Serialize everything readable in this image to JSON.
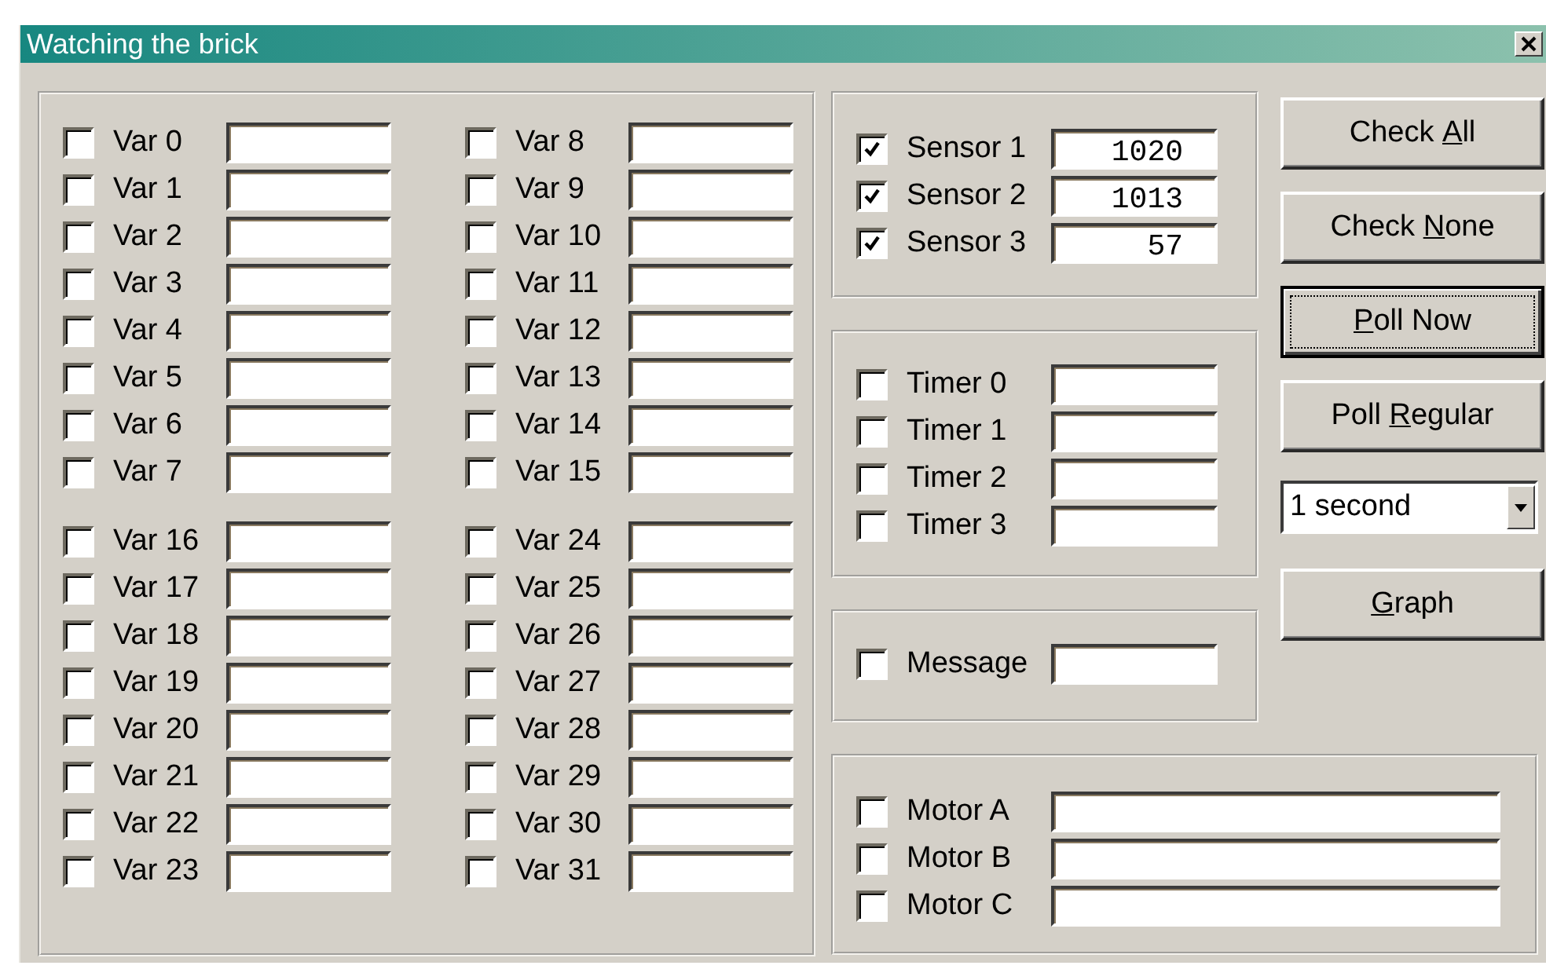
{
  "window": {
    "title": "Watching the brick"
  },
  "variable_blocks": [
    {
      "columns": [
        {
          "items": [
            {
              "label": "Var 0",
              "checked": false
            },
            {
              "label": "Var 1",
              "checked": false
            },
            {
              "label": "Var 2",
              "checked": false
            },
            {
              "label": "Var 3",
              "checked": false
            },
            {
              "label": "Var 4",
              "checked": false
            },
            {
              "label": "Var 5",
              "checked": false
            },
            {
              "label": "Var 6",
              "checked": false
            },
            {
              "label": "Var 7",
              "checked": false
            }
          ]
        },
        {
          "items": [
            {
              "label": "Var 8",
              "checked": false
            },
            {
              "label": "Var 9",
              "checked": false
            },
            {
              "label": "Var 10",
              "checked": false
            },
            {
              "label": "Var 11",
              "checked": false
            },
            {
              "label": "Var 12",
              "checked": false
            },
            {
              "label": "Var 13",
              "checked": false
            },
            {
              "label": "Var 14",
              "checked": false
            },
            {
              "label": "Var 15",
              "checked": false
            }
          ]
        }
      ]
    },
    {
      "columns": [
        {
          "items": [
            {
              "label": "Var 16",
              "checked": false
            },
            {
              "label": "Var 17",
              "checked": false
            },
            {
              "label": "Var 18",
              "checked": false
            },
            {
              "label": "Var 19",
              "checked": false
            },
            {
              "label": "Var 20",
              "checked": false
            },
            {
              "label": "Var 21",
              "checked": false
            },
            {
              "label": "Var 22",
              "checked": false
            },
            {
              "label": "Var 23",
              "checked": false
            }
          ]
        },
        {
          "items": [
            {
              "label": "Var 24",
              "checked": false
            },
            {
              "label": "Var 25",
              "checked": false
            },
            {
              "label": "Var 26",
              "checked": false
            },
            {
              "label": "Var 27",
              "checked": false
            },
            {
              "label": "Var 28",
              "checked": false
            },
            {
              "label": "Var 29",
              "checked": false
            },
            {
              "label": "Var 30",
              "checked": false
            },
            {
              "label": "Var 31",
              "checked": false
            }
          ]
        }
      ]
    }
  ],
  "sensors": [
    {
      "label": "Sensor 1",
      "checked": true,
      "value": "1020"
    },
    {
      "label": "Sensor 2",
      "checked": true,
      "value": "1013"
    },
    {
      "label": "Sensor 3",
      "checked": true,
      "value": "57"
    }
  ],
  "timers": [
    {
      "label": "Timer 0",
      "checked": false
    },
    {
      "label": "Timer 1",
      "checked": false
    },
    {
      "label": "Timer 2",
      "checked": false
    },
    {
      "label": "Timer 3",
      "checked": false
    }
  ],
  "message": {
    "label": "Message",
    "checked": false
  },
  "motors": [
    {
      "label": "Motor A",
      "checked": false
    },
    {
      "label": "Motor B",
      "checked": false
    },
    {
      "label": "Motor C",
      "checked": false
    }
  ],
  "buttons": [
    {
      "label": {
        "before": "Check ",
        "key": "A",
        "after": "ll"
      },
      "focused": false
    },
    {
      "label": {
        "before": "Check ",
        "key": "N",
        "after": "one"
      },
      "focused": false
    },
    {
      "label": {
        "key": "P",
        "after": "oll Now"
      },
      "focused": true
    },
    {
      "label": {
        "before": "Poll ",
        "key": "R",
        "after": "egular"
      },
      "focused": false
    }
  ],
  "interval": {
    "value": "1 second"
  },
  "graph_button": {
    "label": {
      "key": "G",
      "after": "raph"
    },
    "focused": false
  }
}
